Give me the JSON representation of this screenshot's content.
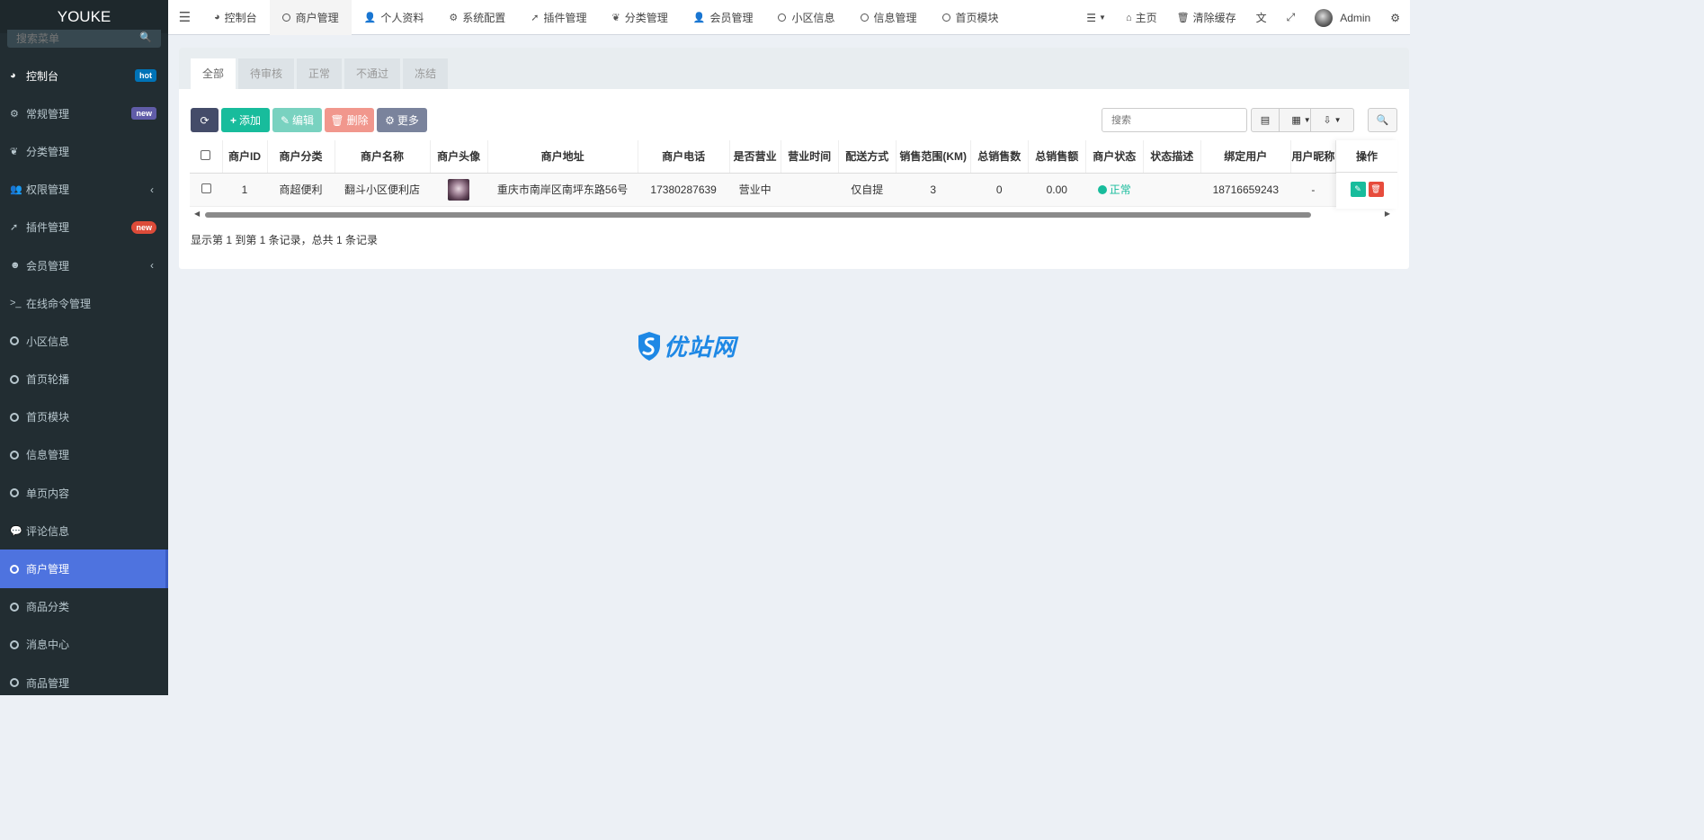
{
  "app": {
    "logo": "YOUKE"
  },
  "sidebar": {
    "search_placeholder": "搜索菜单",
    "items": [
      {
        "label": "控制台",
        "icon": "dashboard-icon",
        "glyph": "◕",
        "badge": "hot",
        "badge_color": "#0073b7"
      },
      {
        "label": "常规管理",
        "icon": "cogs-icon",
        "glyph": "⚙",
        "badge": "new",
        "badge_color": "#605ca8"
      },
      {
        "label": "分类管理",
        "icon": "leaf-icon",
        "glyph": "❦"
      },
      {
        "label": "权限管理",
        "icon": "group-icon",
        "glyph": "👥",
        "chevron": "‹"
      },
      {
        "label": "插件管理",
        "icon": "rocket-icon",
        "glyph": "➚",
        "badge": "new",
        "badge_color": "#dd4b39"
      },
      {
        "label": "会员管理",
        "icon": "user-circle-icon",
        "glyph": "☻",
        "chevron": "‹"
      },
      {
        "label": "在线命令管理",
        "icon": "terminal-icon",
        "glyph": ">_"
      },
      {
        "label": "小区信息",
        "icon": "circle-icon"
      },
      {
        "label": "首页轮播",
        "icon": "circle-icon"
      },
      {
        "label": "首页模块",
        "icon": "circle-icon"
      },
      {
        "label": "信息管理",
        "icon": "circle-icon"
      },
      {
        "label": "单页内容",
        "icon": "circle-icon"
      },
      {
        "label": "评论信息",
        "icon": "comment-icon",
        "glyph": "💬"
      },
      {
        "label": "商户管理",
        "icon": "circle-icon",
        "active": true
      },
      {
        "label": "商品分类",
        "icon": "circle-icon"
      },
      {
        "label": "消息中心",
        "icon": "circle-icon"
      },
      {
        "label": "商品管理",
        "icon": "circle-icon"
      }
    ]
  },
  "topnav": {
    "tabs": [
      {
        "label": "控制台",
        "icon": "dashboard-icon",
        "glyph": "◕"
      },
      {
        "label": "商户管理",
        "icon": "circle-icon",
        "active": true
      },
      {
        "label": "个人资料",
        "icon": "user-icon",
        "glyph": "👤"
      },
      {
        "label": "系统配置",
        "icon": "cog-icon",
        "glyph": "⚙"
      },
      {
        "label": "插件管理",
        "icon": "rocket-icon",
        "glyph": "➚"
      },
      {
        "label": "分类管理",
        "icon": "leaf-icon",
        "glyph": "❦"
      },
      {
        "label": "会员管理",
        "icon": "user-icon",
        "glyph": "👤"
      },
      {
        "label": "小区信息",
        "icon": "circle-icon"
      },
      {
        "label": "信息管理",
        "icon": "circle-icon"
      },
      {
        "label": "首页模块",
        "icon": "circle-icon"
      }
    ],
    "home": "主页",
    "clear_cache": "清除缓存",
    "user": "Admin"
  },
  "subtabs": [
    "全部",
    "待审核",
    "正常",
    "不通过",
    "冻结"
  ],
  "toolbar": {
    "add": "添加",
    "edit": "编辑",
    "delete": "删除",
    "more": "更多",
    "search_placeholder": "搜索"
  },
  "table": {
    "headers": [
      "商户ID",
      "商户分类",
      "商户名称",
      "商户头像",
      "商户地址",
      "商户电话",
      "是否营业",
      "营业时间",
      "配送方式",
      "销售范围(KM)",
      "总销售数",
      "总销售额",
      "商户状态",
      "状态描述",
      "绑定用户",
      "用户昵称"
    ],
    "op_header": "操作",
    "rows": [
      {
        "id": "1",
        "category": "商超便利",
        "name": "翻斗小区便利店",
        "address": "重庆市南岸区南坪东路56号",
        "phone": "17380287639",
        "open": "营业中",
        "hours": "",
        "delivery": "仅自提",
        "range": "3",
        "sales_count": "0",
        "sales_amount": "0.00",
        "status": "正常",
        "status_desc": "",
        "bind_user": "18716659243",
        "nickname": "-"
      }
    ]
  },
  "pagination": {
    "info": "显示第 1 到第 1 条记录，总共 1 条记录"
  },
  "watermark": {
    "text": "优站网"
  }
}
